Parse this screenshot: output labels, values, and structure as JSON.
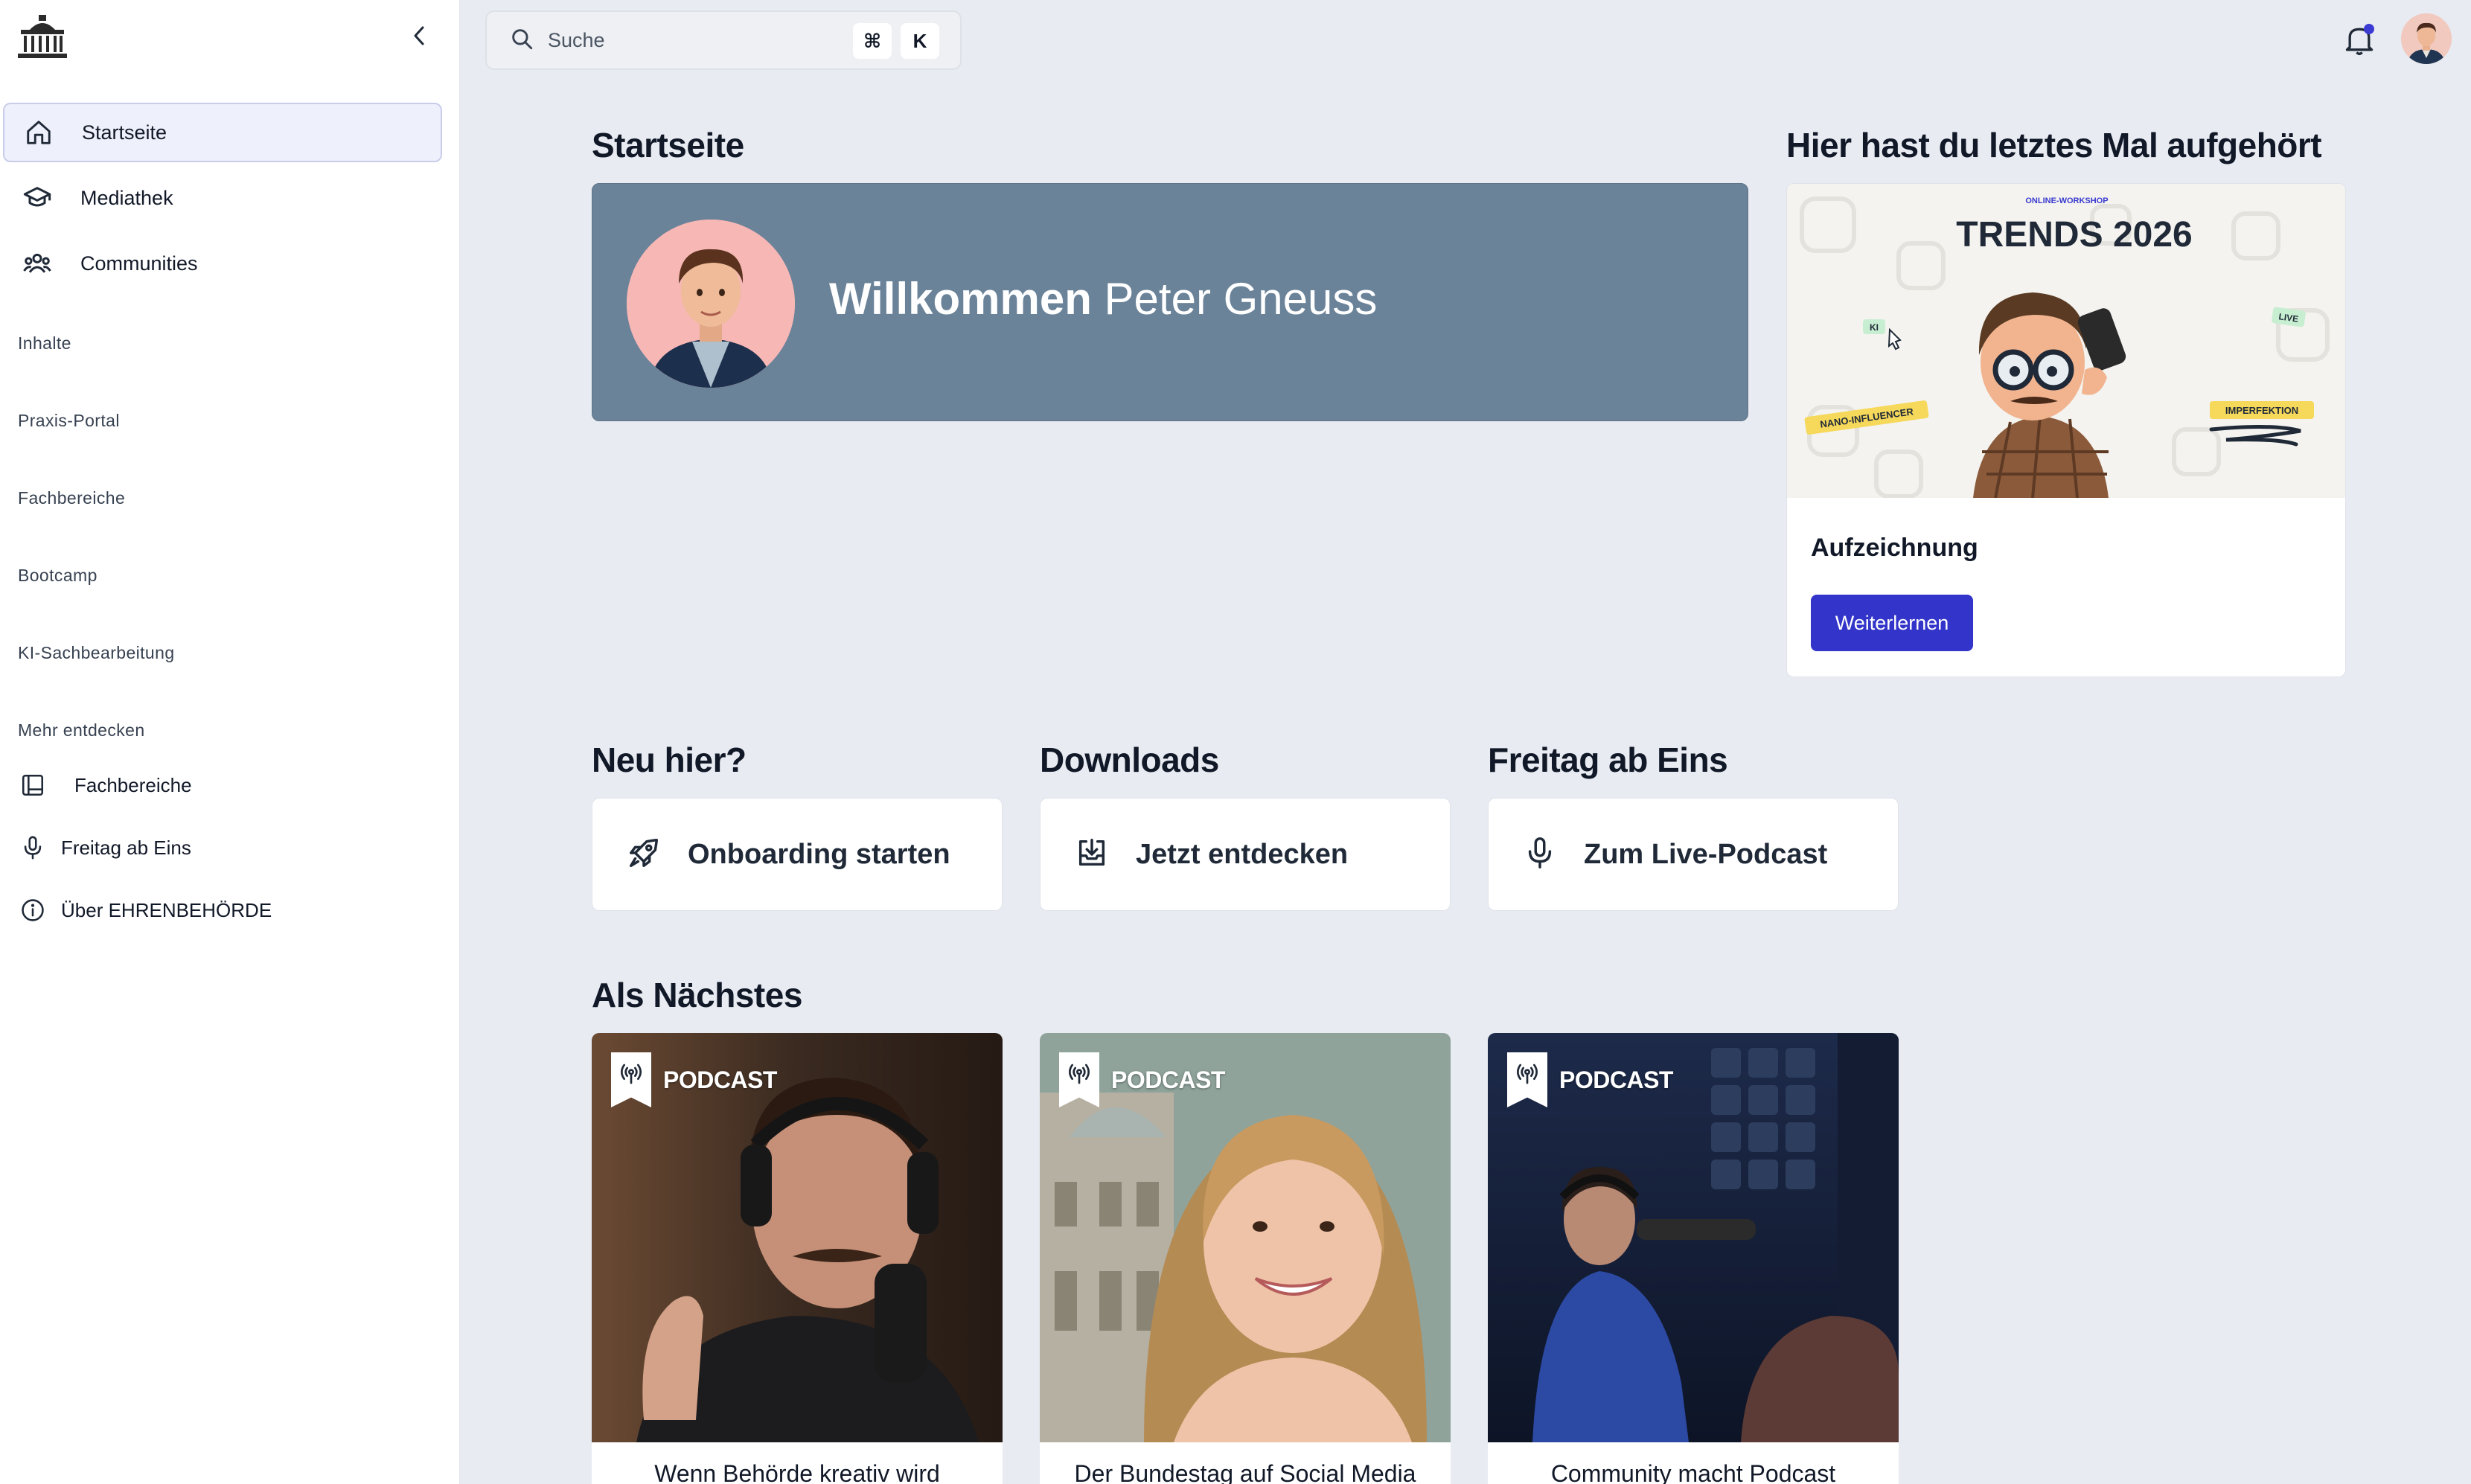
{
  "sidebar": {
    "nav": [
      {
        "label": "Startseite",
        "icon": "home-icon",
        "active": true
      },
      {
        "label": "Mediathek",
        "icon": "graduation-cap-icon",
        "active": false
      },
      {
        "label": "Communities",
        "icon": "users-icon",
        "active": false
      }
    ],
    "sections": [
      "Inhalte",
      "Praxis-Portal",
      "Fachbereiche",
      "Bootcamp",
      "KI-Sachbearbeitung",
      "Mehr entdecken"
    ],
    "more": [
      {
        "label": "Fachbereiche",
        "icon": "book-icon"
      },
      {
        "label": "Freitag ab Eins",
        "icon": "microphone-icon"
      },
      {
        "label": "Über EHRENBEHÖRDE",
        "icon": "info-icon"
      }
    ]
  },
  "topbar": {
    "search_label": "Suche",
    "shortcut": [
      "⌘",
      "K"
    ]
  },
  "home": {
    "title": "Startseite",
    "welcome_bold": "Willkommen",
    "welcome_name": "Peter Gneuss"
  },
  "resume": {
    "title": "Hier hast du letztes Mal aufgehört",
    "thumb": {
      "kicker": "ONLINE-WORKSHOP",
      "headline": "TRENDS 2026",
      "tags": [
        "KI",
        "LIVE",
        "NANO-INFLUENCER",
        "IMPERFEKTION"
      ]
    },
    "caption": "Aufzeichnung",
    "button": "Weiterlernen"
  },
  "quick": [
    {
      "heading": "Neu hier?",
      "label": "Onboarding starten",
      "icon": "rocket-icon"
    },
    {
      "heading": "Downloads",
      "label": "Jetzt entdecken",
      "icon": "download-tray-icon"
    },
    {
      "heading": "Freitag ab Eins",
      "label": "Zum Live-Podcast",
      "icon": "microphone-icon"
    }
  ],
  "next": {
    "title": "Als Nächstes",
    "items": [
      {
        "tag": "PODCAST",
        "title": "Wenn Behörde kreativ wird"
      },
      {
        "tag": "PODCAST",
        "title": "Der Bundestag auf Social Media"
      },
      {
        "tag": "PODCAST",
        "title": "Community macht Podcast"
      }
    ]
  },
  "colors": {
    "accent": "#3334c9",
    "welcome_bg": "#6b8399",
    "page_bg": "#e8ebf1"
  }
}
